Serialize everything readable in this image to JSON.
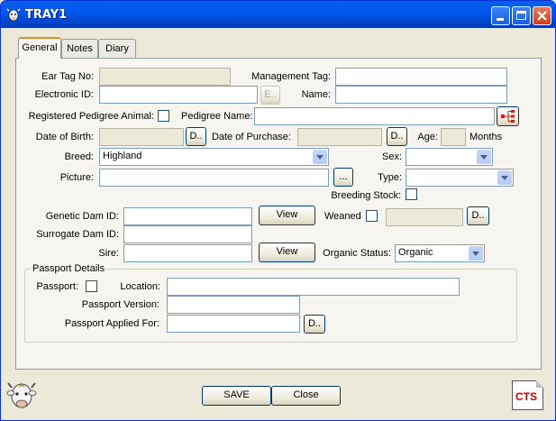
{
  "window": {
    "title": "TRAY1"
  },
  "tabs": [
    {
      "label": "General"
    },
    {
      "label": "Notes"
    },
    {
      "label": "Diary"
    }
  ],
  "form": {
    "ear_tag_label": "Ear Tag No:",
    "management_tag_label": "Management Tag:",
    "electronic_id_label": "Electronic ID:",
    "e_button": "E..",
    "name_label": "Name:",
    "registered_pedigree_label": "Registered Pedigree Animal:",
    "pedigree_name_label": "Pedigree Name:",
    "dob_label": "Date of Birth:",
    "d_button": "D..",
    "dop_label": "Date of Purchase:",
    "age_label": "Age:",
    "months_label": "Months",
    "breed_label": "Breed:",
    "breed_value": "Highland",
    "sex_label": "Sex:",
    "picture_label": "Picture:",
    "browse_button": "...",
    "type_label": "Type:",
    "breeding_stock_label": "Breeding Stock:",
    "genetic_dam_label": "Genetic Dam ID:",
    "view_button": "View",
    "weaned_label": "Weaned",
    "surrogate_dam_label": "Surrogate Dam ID:",
    "sire_label": "Sire:",
    "organic_status_label": "Organic Status:",
    "organic_status_value": "Organic"
  },
  "passport": {
    "group_label": "Passport Details",
    "passport_label": "Passport:",
    "location_label": "Location:",
    "version_label": "Passport Version:",
    "applied_label": "Passport Applied For:",
    "d_button": "D.."
  },
  "footer": {
    "save_label": "SAVE",
    "close_label": "Close",
    "logo_text": "CTS"
  },
  "colors": {
    "titlebar": "#0058ee",
    "tab_accent": "#e68b2c",
    "cts_red": "#cc0000"
  }
}
